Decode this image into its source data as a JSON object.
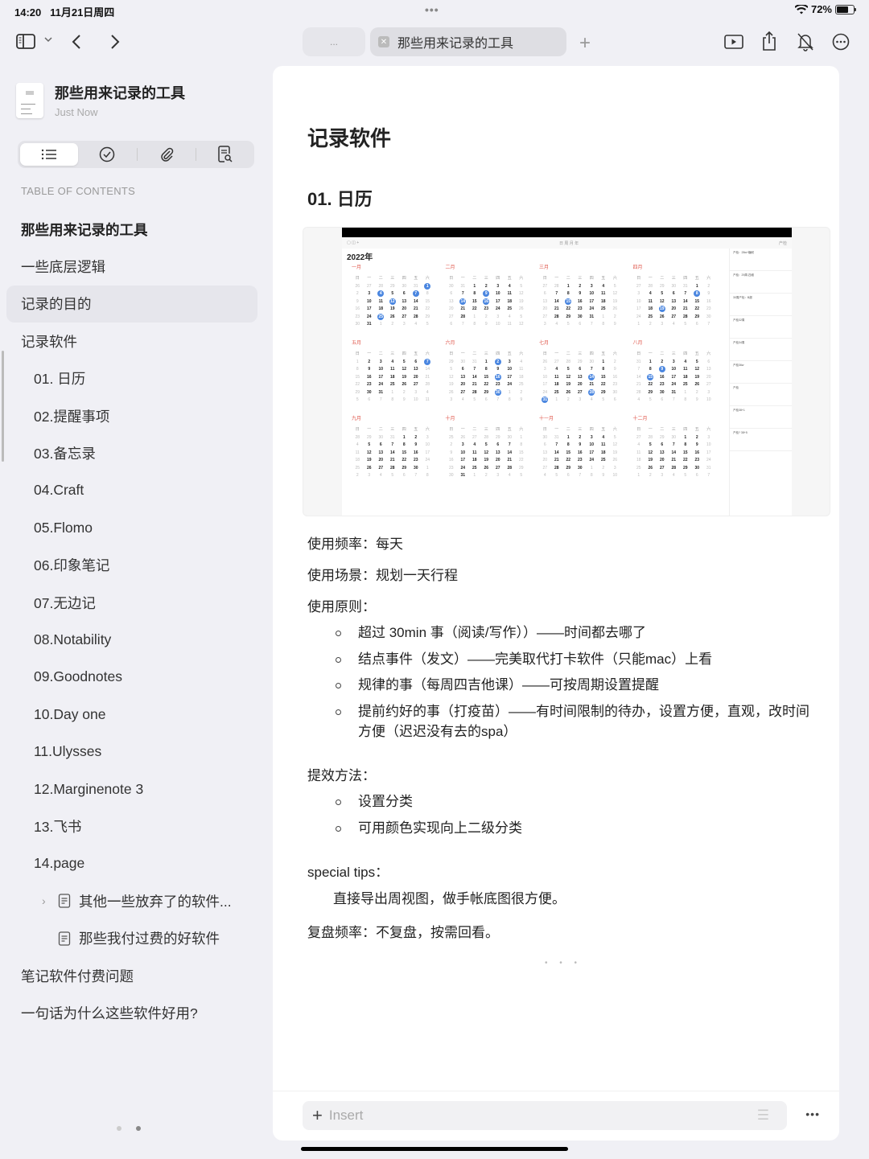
{
  "status": {
    "time": "14:20",
    "date": "11月21日周四",
    "battery": "72%",
    "battery_level": 0.72
  },
  "topbar": {
    "tab_inactive": "...",
    "tab_active": "那些用来记录的工具"
  },
  "doc": {
    "title": "那些用来记录的工具",
    "subtitle": "Just Now"
  },
  "sidebar": {
    "toc_label": "TABLE OF CONTENTS",
    "items": [
      {
        "label": "那些用来记录的工具",
        "level": 0,
        "bold": true
      },
      {
        "label": "一些底层逻辑",
        "level": 0
      },
      {
        "label": "记录的目的",
        "level": 0,
        "highlighted": true
      },
      {
        "label": "记录软件",
        "level": 0
      },
      {
        "label": "01. 日历",
        "level": 1
      },
      {
        "label": "02.提醒事项",
        "level": 1
      },
      {
        "label": "03.备忘录",
        "level": 1
      },
      {
        "label": "04.Craft",
        "level": 1
      },
      {
        "label": "05.Flomo",
        "level": 1
      },
      {
        "label": "06.印象笔记",
        "level": 1
      },
      {
        "label": "07.无边记",
        "level": 1
      },
      {
        "label": "08.Notability",
        "level": 1
      },
      {
        "label": "09.Goodnotes",
        "level": 1
      },
      {
        "label": "10.Day one",
        "level": 1
      },
      {
        "label": "11.Ulysses",
        "level": 1
      },
      {
        "label": "12.Marginenote 3",
        "level": 1
      },
      {
        "label": "13.飞书",
        "level": 1
      },
      {
        "label": "14.page",
        "level": 1
      },
      {
        "label": "其他一些放弃了的软件...",
        "level": 2,
        "page": true,
        "expandable": true
      },
      {
        "label": "那些我付过费的好软件",
        "level": 2,
        "page": true
      },
      {
        "label": "笔记软件付费问题",
        "level": 0
      },
      {
        "label": "一句话为什么这些软件好用?",
        "level": 0
      }
    ]
  },
  "main": {
    "h1": "记录软件",
    "h2": "01. 日历",
    "calendar_image": {
      "year": "2022年",
      "toolbar": [
        "日",
        "周",
        "月",
        "年"
      ],
      "search": "产检",
      "months": [
        {
          "name": "一月",
          "lead": [
            26,
            27,
            28,
            29,
            30,
            31
          ],
          "days": 31,
          "circled": [
            1,
            4,
            7,
            12,
            25
          ]
        },
        {
          "name": "二月",
          "lead": [
            30,
            31
          ],
          "days": 28,
          "circled": [
            9,
            14,
            16
          ]
        },
        {
          "name": "三月",
          "lead": [
            27,
            28
          ],
          "days": 31,
          "circled": [
            15
          ]
        },
        {
          "name": "四月",
          "lead": [
            27,
            28,
            29,
            30,
            31
          ],
          "days": 30,
          "circled": [
            8,
            19
          ]
        },
        {
          "name": "五月",
          "lead": [],
          "days": 31,
          "circled": [
            7
          ]
        },
        {
          "name": "六月",
          "lead": [
            29,
            30,
            31
          ],
          "days": 30,
          "circled": [
            2,
            16,
            30
          ]
        },
        {
          "name": "七月",
          "lead": [
            26,
            27,
            28,
            29,
            30
          ],
          "days": 31,
          "circled": [
            14,
            28,
            31
          ]
        },
        {
          "name": "八月",
          "lead": [
            31
          ],
          "days": 31,
          "circled": [
            9,
            15
          ]
        },
        {
          "name": "九月",
          "lead": [
            28,
            29,
            30,
            31
          ],
          "days": 30,
          "circled": []
        },
        {
          "name": "十月",
          "lead": [
            25,
            26,
            27,
            28,
            29,
            30
          ],
          "days": 31,
          "circled": []
        },
        {
          "name": "十一月",
          "lead": [
            30,
            31
          ],
          "days": 30,
          "circled": []
        },
        {
          "name": "十二月",
          "lead": [
            27,
            28,
            29,
            30
          ],
          "days": 31,
          "circled": []
        }
      ],
      "weekdays": [
        "日",
        "一",
        "二",
        "三",
        "四",
        "五",
        "六"
      ],
      "events": [
        "产检：28w+糖耐",
        "产检：29周-四维",
        "30周产检：B超",
        "产检32周",
        "产检34周",
        "产检36w",
        "产检",
        "产检38+1",
        "产检? 38+5"
      ]
    },
    "freq": "使用频率：每天",
    "scene": "使用场景：规划一天行程",
    "principle_label": "使用原则：",
    "principles": [
      "超过 30min 事（阅读/写作））——时间都去哪了",
      "结点事件（发文）——完美取代打卡软件（只能mac）上看",
      "规律的事（每周四吉他课）——可按周期设置提醒",
      "提前约好的事（打疫苗）——有时间限制的待办，设置方便，直观，改时间方便（迟迟没有去的spa）"
    ],
    "method_label": "提效方法：",
    "methods": [
      "设置分类",
      "可用颜色实现向上二级分类"
    ],
    "tips_label": "special tips：",
    "tips": "直接导出周视图，做手帐底图很方便。",
    "review": "复盘频率：不复盘，按需回看。",
    "insert_placeholder": "Insert"
  }
}
